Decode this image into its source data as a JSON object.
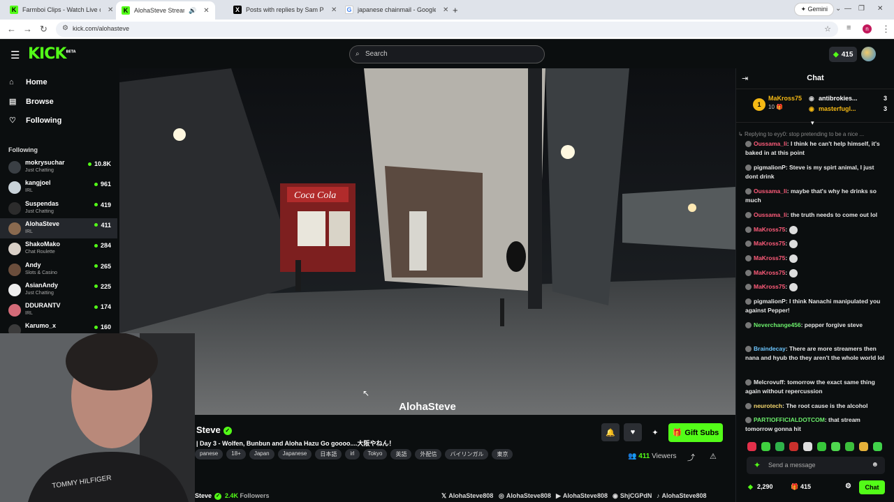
{
  "browser": {
    "tabs": [
      {
        "title": "Farmboi Clips - Watch Live on K",
        "icon": "kick-favicon"
      },
      {
        "title": "AlohaSteve Stream - Watch",
        "icon": "kick-favicon"
      },
      {
        "title": "Posts with replies by Sam Pepp",
        "icon": "x-favicon"
      },
      {
        "title": "japanese chainmail - Google Se",
        "icon": "google-favicon"
      }
    ],
    "url": "kick.com/alohasteve",
    "gemini_label": "Gemini"
  },
  "topbar": {
    "logo": "KICK",
    "logo_badge": "BETA",
    "search_placeholder": "Search",
    "points": "415"
  },
  "sidebar": {
    "nav": [
      {
        "label": "Home",
        "icon": "home-icon"
      },
      {
        "label": "Browse",
        "icon": "browse-icon"
      },
      {
        "label": "Following",
        "icon": "heart-icon"
      }
    ],
    "following_label": "Following",
    "following": [
      {
        "name": "mokrysuchar",
        "category": "Just Chatting",
        "viewers": "10.8K"
      },
      {
        "name": "kangjoel",
        "category": "IRL",
        "viewers": "961"
      },
      {
        "name": "Suspendas",
        "category": "Just Chatting",
        "viewers": "419"
      },
      {
        "name": "AlohaSteve",
        "category": "IRL",
        "viewers": "411"
      },
      {
        "name": "ShakoMako",
        "category": "Chat Roulette",
        "viewers": "284"
      },
      {
        "name": "Andy",
        "category": "Slots & Casino",
        "viewers": "265"
      },
      {
        "name": "AsianAndy",
        "category": "Just Chatting",
        "viewers": "225"
      },
      {
        "name": "DDURANTV",
        "category": "IRL",
        "viewers": "174"
      },
      {
        "name": "Karumo_x",
        "category": "",
        "viewers": "160"
      }
    ]
  },
  "video": {
    "overlay_name": "AlohaSteve",
    "sign_text": "Coca Cola"
  },
  "webcam": {
    "shirt_text": "TOMMY HILFIGER"
  },
  "stream": {
    "name": "Steve",
    "title": "| Day 3 - Wolfen, Bunbun and Aloha Hazu Go goooo....大阪やねん！",
    "tags": [
      "panese",
      "18+",
      "Japan",
      "Japanese",
      "日本語",
      "irl",
      "Tokyo",
      "英語",
      "外配信",
      "バイリンガル",
      "東京"
    ],
    "gift_label": "Gift Subs",
    "viewers": "411",
    "viewers_label": "Viewers",
    "bottom_name": "Steve",
    "followers": "2.4K",
    "followers_label": "Followers",
    "socials": [
      {
        "icon": "x-icon",
        "label": "AlohaSteve808"
      },
      {
        "icon": "instagram-icon",
        "label": "AlohaSteve808"
      },
      {
        "icon": "youtube-icon",
        "label": "AlohaSteve808"
      },
      {
        "icon": "discord-icon",
        "label": "ShjCGPdN"
      },
      {
        "icon": "tiktok-icon",
        "label": "AlohaSteve808"
      }
    ]
  },
  "chat": {
    "title": "Chat",
    "leaderboard": {
      "rank": "1",
      "top_user": "MaKross75",
      "top_count": "10",
      "others": [
        {
          "name": "antibrokies...",
          "count": "3"
        },
        {
          "name": "masterfugl...",
          "count": "3"
        }
      ]
    },
    "reply_text": "Replying to eyy0: stop pretending to be a nice ...",
    "messages": [
      {
        "user": "Oussama_li",
        "color": "#ff5c7a",
        "text": "I think he can't help himself, it's baked in at this point"
      },
      {
        "user": "pigmalionP",
        "color": "#e8e8e8",
        "text": "Steve is my spirt animal, I just dont drink"
      },
      {
        "user": "Oussama_li",
        "color": "#ff5c7a",
        "text": "maybe that's why he drinks so much"
      },
      {
        "user": "Oussama_li",
        "color": "#ff5c7a",
        "text": "the truth needs to come out lol"
      },
      {
        "user": "MaKross75",
        "color": "#ff5c7a",
        "text": ""
      },
      {
        "user": "MaKross75",
        "color": "#ff5c7a",
        "text": ""
      },
      {
        "user": "MaKross75",
        "color": "#ff5c7a",
        "text": ""
      },
      {
        "user": "MaKross75",
        "color": "#ff5c7a",
        "text": ""
      },
      {
        "user": "MaKross75",
        "color": "#ff5c7a",
        "text": ""
      },
      {
        "user": "pigmalionP",
        "color": "#e8e8e8",
        "text": "I think Nanachi manipulated you against Pepper!"
      },
      {
        "user": "Neverchange456",
        "color": "#6cf06c",
        "text": "pepper forgive steve"
      },
      {
        "user": "Braindecay",
        "color": "#6cc6ff",
        "text": "There are more streamers then nana and hyub tho they aren't the whole world lol"
      },
      {
        "user": "Melcrovuff",
        "color": "#e8e8e8",
        "text": "tomorrow the exact same thing again without repercussion"
      },
      {
        "user": "neurotech",
        "color": "#f5d76e",
        "text": "The root cause is the alcohol"
      },
      {
        "user": "PARTIOFFICIALDOTCOM",
        "color": "#6cf06c",
        "text": "that stream tomorrow gonna hit"
      }
    ],
    "input_placeholder": "Send a message",
    "points": "2,290",
    "gifts": "415",
    "send_label": "Chat"
  }
}
